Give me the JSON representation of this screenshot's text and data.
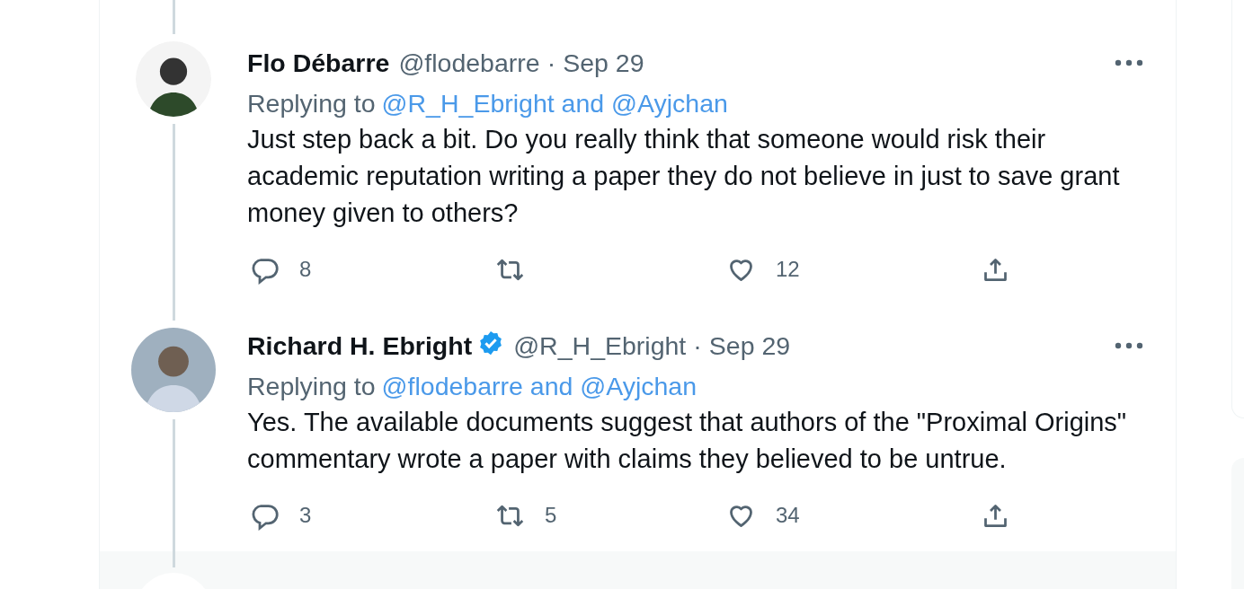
{
  "tweets": [
    {
      "author": "Flo Débarre",
      "verified": false,
      "handle": "@flodebarre",
      "separator": "·",
      "date": "Sep 29",
      "replying_prefix": "Replying to",
      "replying_to": "@R_H_Ebright and @Ayjchan",
      "text": "Just step back a bit. Do you really think that someone would risk their academic reputation writing a paper they do not believe in just to save grant money given to others?",
      "actions": [
        {
          "kind": "reply",
          "count": "8"
        },
        {
          "kind": "retweet"
        },
        {
          "kind": "like",
          "count": "12"
        },
        {
          "kind": "share"
        }
      ]
    },
    {
      "author": "Richard H. Ebright",
      "verified": true,
      "handle": "@R_H_Ebright",
      "separator": "·",
      "date": "Sep 29",
      "replying_prefix": "Replying to",
      "replying_to": "@flodebarre and @Ayjchan",
      "text": "Yes. The available documents suggest that authors of the \"Proximal Origins\" commentary wrote a paper with claims they believed to be untrue.",
      "actions": [
        {
          "kind": "reply",
          "count": "3"
        },
        {
          "kind": "retweet",
          "count": "5"
        },
        {
          "kind": "like",
          "count": "34"
        },
        {
          "kind": "share"
        }
      ]
    }
  ]
}
